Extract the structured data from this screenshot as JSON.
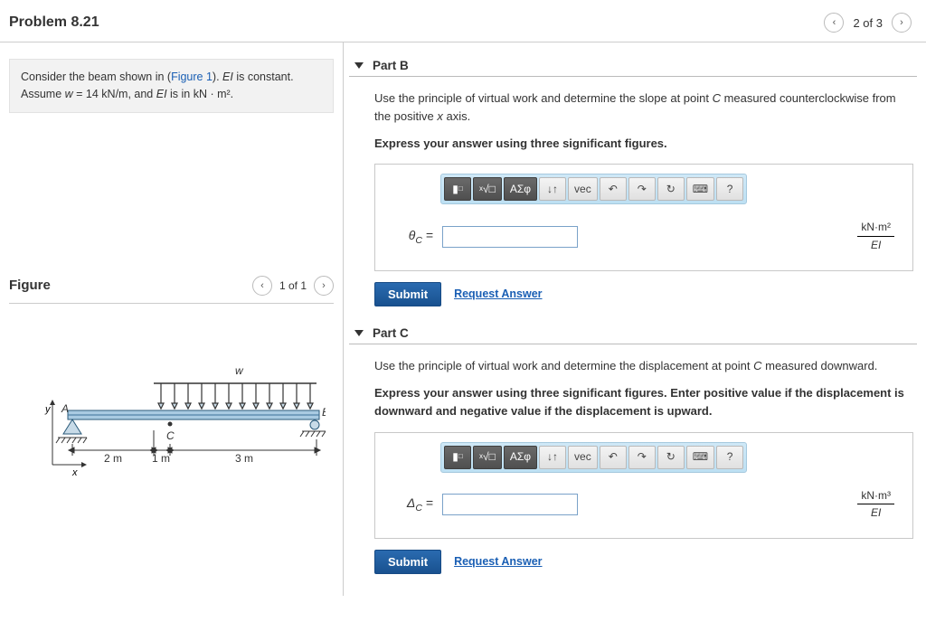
{
  "header": {
    "title": "Problem 8.21",
    "pager": "2 of 3"
  },
  "problem": {
    "text_prefix": "Consider the beam shown in (",
    "figure_link": "Figure 1",
    "text_mid": "). ",
    "text_const": " is constant. Assume ",
    "text_w_eq": "w",
    "text_w_val": " = 14 kN/m, and ",
    "text_ei": "EI",
    "text_end": " is in kN · m²."
  },
  "figure": {
    "heading": "Figure",
    "pager": "1 of 1",
    "labels": {
      "A": "A",
      "B": "B",
      "C": "C",
      "w": "w",
      "x": "x",
      "y": "y",
      "d2m": "2 m",
      "d1m": "1 m",
      "d3m": "3 m"
    }
  },
  "parts": [
    {
      "title": "Part B",
      "desc_html": "Use the principle of virtual work and determine the slope at point <i>C</i> measured counterclockwise from the positive <i>x</i> axis.",
      "bold": "Express your answer using three significant figures.",
      "var_html": "θ<sub>C</sub> =",
      "unit_num": "kN·m²",
      "unit_den": "EI",
      "submit": "Submit",
      "request": "Request Answer"
    },
    {
      "title": "Part C",
      "desc_html": "Use the principle of virtual work and determine the displacement at point <i>C</i> measured downward.",
      "bold": "Express your answer using three significant figures. Enter positive value if the displacement is downward and negative value if the displacement is upward.",
      "var_html": "Δ<sub>C</sub> =",
      "unit_num": "kN·m³",
      "unit_den": "EI",
      "submit": "Submit",
      "request": "Request Answer"
    }
  ],
  "toolbar": {
    "greek": "ΑΣφ",
    "updown": "↓↑",
    "vec": "vec",
    "undo": "↶",
    "redo": "↷",
    "reset": "↻",
    "keyboard": "⌨",
    "help": "?"
  }
}
